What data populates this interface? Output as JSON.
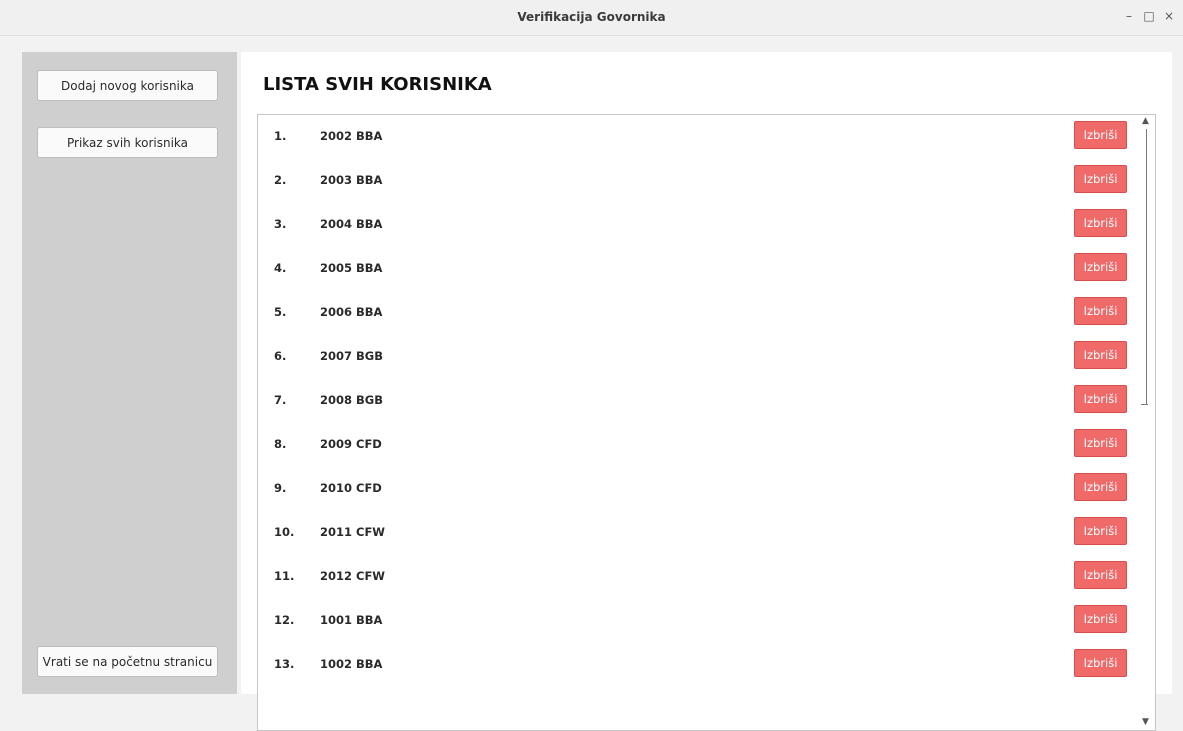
{
  "window": {
    "title": "Verifikacija Govornika",
    "controls": {
      "minimize": "–",
      "maximize": "□",
      "close": "×"
    }
  },
  "sidebar": {
    "add_user_label": "Dodaj novog korisnika",
    "show_all_label": "Prikaz svih korisnika",
    "back_label": "Vrati se na početnu stranicu"
  },
  "main": {
    "heading": "LISTA SVIH KORISNIKA",
    "delete_label": "Izbriši",
    "users": [
      {
        "num": "1.",
        "name": "2002 BBA"
      },
      {
        "num": "2.",
        "name": "2003 BBA"
      },
      {
        "num": "3.",
        "name": "2004 BBA"
      },
      {
        "num": "4.",
        "name": "2005 BBA"
      },
      {
        "num": "5.",
        "name": "2006 BBA"
      },
      {
        "num": "6.",
        "name": "2007 BGB"
      },
      {
        "num": "7.",
        "name": "2008 BGB"
      },
      {
        "num": "8.",
        "name": "2009 CFD"
      },
      {
        "num": "9.",
        "name": "2010 CFD"
      },
      {
        "num": "10.",
        "name": "2011 CFW"
      },
      {
        "num": "11.",
        "name": "2012 CFW"
      },
      {
        "num": "12.",
        "name": "1001 BBA"
      },
      {
        "num": "13.",
        "name": "1002 BBA"
      }
    ]
  },
  "colors": {
    "delete_button": "#f06a6a",
    "sidebar_bg": "#cfcfcf"
  }
}
